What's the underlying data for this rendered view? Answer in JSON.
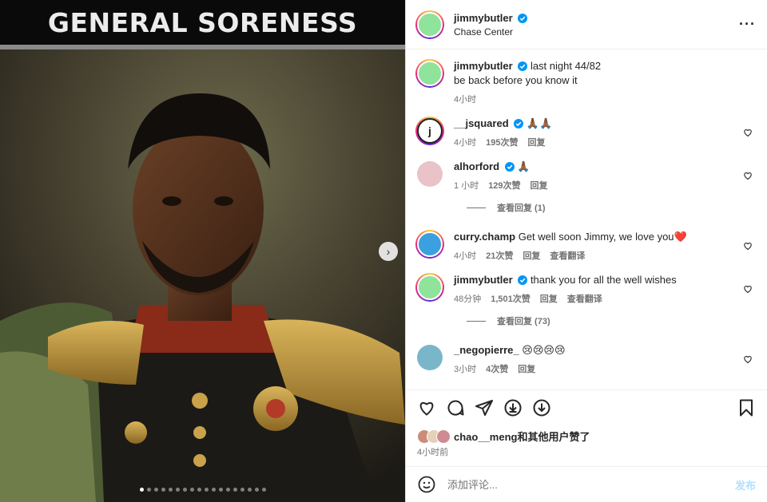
{
  "media": {
    "banner_text": "GENERAL SORENESS",
    "slide_count": 18,
    "active_slide": 0
  },
  "header": {
    "username": "jimmybutler",
    "location": "Chase Center"
  },
  "caption": {
    "username": "jimmybutler",
    "text_line1": "last night 44/82",
    "text_line2": "be back before you know it",
    "time": "4小时"
  },
  "comments": [
    {
      "username": "__jsquared",
      "text": "🙏🏾🙏🏾",
      "time": "4小时",
      "likes": "195次赞",
      "reply": "回复",
      "translate": ""
    },
    {
      "username": "alhorford",
      "text": "🙏🏾",
      "time": "1 小时",
      "likes": "129次赞",
      "reply": "回复",
      "translate": "",
      "view_replies": "查看回复 (1)"
    },
    {
      "username": "curry.champ",
      "text": "Get well soon Jimmy, we love you❤️",
      "time": "4小时",
      "likes": "21次赞",
      "reply": "回复",
      "translate": "查看翻译"
    },
    {
      "username": "jimmybutler",
      "text": "thank you for all the well wishes",
      "time": "48分钟",
      "likes": "1,501次赞",
      "reply": "回复",
      "translate": "查看翻译",
      "view_replies": "查看回复 (73)"
    },
    {
      "username": "_negopierre_",
      "text": "😢😢😢😢",
      "time": "3小时",
      "likes": "4次赞",
      "reply": "回复",
      "translate": ""
    }
  ],
  "likes_summary": {
    "name": "chao__meng",
    "suffix": "和其他用户赞了",
    "post_time": "4小时前"
  },
  "composer": {
    "placeholder": "添加评论...",
    "post_label": "发布"
  },
  "colors": {
    "verified": "#0095f6",
    "post_button_disabled": "#b2dffc",
    "meta_text": "#737373"
  }
}
